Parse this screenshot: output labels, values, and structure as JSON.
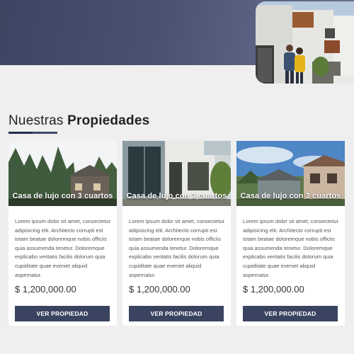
{
  "section": {
    "title_light": "Nuestras ",
    "title_bold": "Propiedades"
  },
  "properties": [
    {
      "title": "Casa de lujo con 3 cuartos",
      "description": "Lorem ipsum dolor sit amet, consectetur adipisicing elit. Architecto corrupti est totam beatae doloremque nobis officiis quia assumenda tenetur. Doloremque explicabo veritatis facilis dolorum quia cupiditate quae eveniet aliquid aspernatur.",
      "price": "$ 1,200,000.00",
      "button_label": "VER PROPIEDAD"
    },
    {
      "title": "Casa de lujo con 3 cuartos",
      "description": "Lorem ipsum dolor sit amet, consectetur adipisicing elit. Architecto corrupti est totam beatae doloremque nobis officiis quia assumenda tenetur. Doloremque explicabo veritatis facilis dolorum quia cupiditate quae eveniet aliquid aspernatur.",
      "price": "$ 1,200,000.00",
      "button_label": "VER PROPIEDAD"
    },
    {
      "title": "Casa de lujo con 3 cuartos",
      "description": "Lorem ipsum dolor sit amet, consectetur adipisicing elit. Architecto corrupti est totam beatae doloremque nobis officiis quia assumenda tenetur. Doloremque explicabo veritatis facilis dolorum quia cupiditate quae eveniet aliquid aspernatur.",
      "price": "$ 1,200,000.00",
      "button_label": "VER PROPIEDAD"
    }
  ],
  "colors": {
    "hero": "#4a5272",
    "button": "#3a4460",
    "accent": "#232f4d"
  }
}
